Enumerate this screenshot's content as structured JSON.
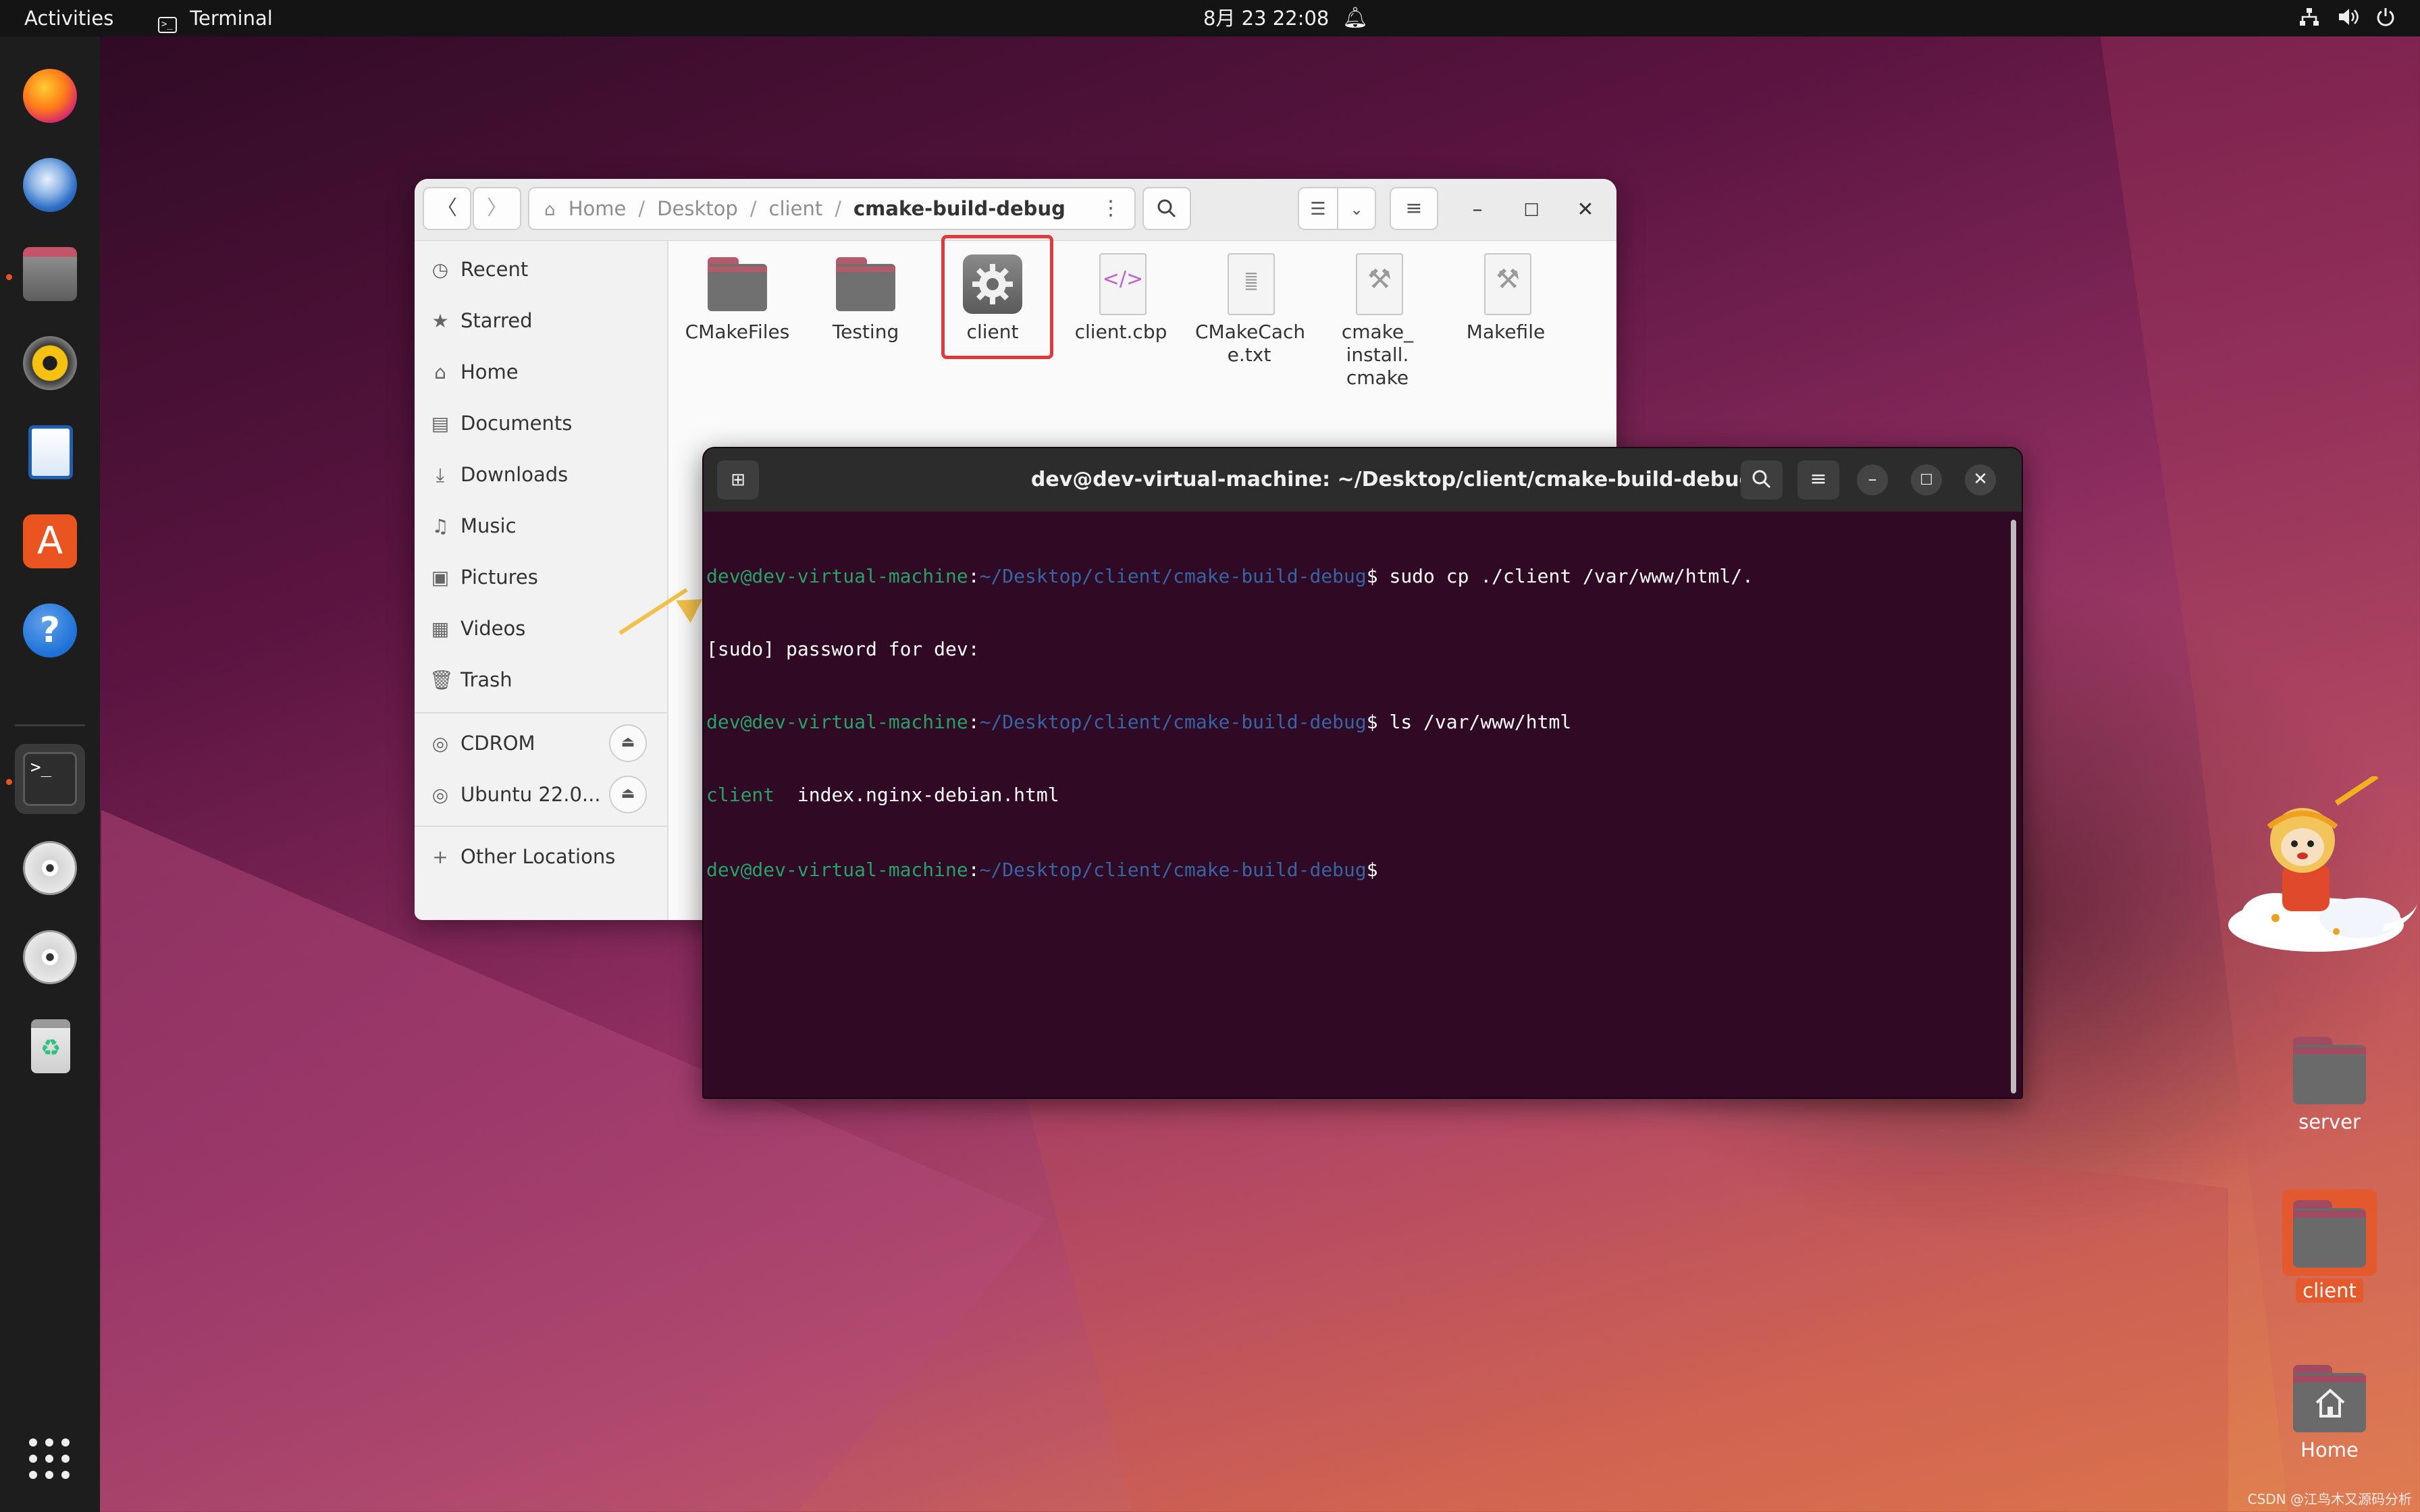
{
  "topbar": {
    "activities": "Activities",
    "app_name": "Terminal",
    "clock": "8月 23  22:08",
    "tray_icons": [
      "network-icon",
      "volume-icon",
      "power-icon"
    ]
  },
  "dock": {
    "apps": [
      "firefox-icon",
      "thunderbird-icon",
      "files-icon",
      "rhythmbox-icon",
      "writer-icon",
      "app-center-icon",
      "help-icon",
      "terminal-icon",
      "disc-icon",
      "disc-icon",
      "trash-icon"
    ],
    "show_apps_icon": "app-grid-icon"
  },
  "files": {
    "path": [
      "Home",
      "Desktop",
      "client",
      "cmake-build-debug"
    ],
    "sidebar": [
      {
        "label": "Recent",
        "icon": "clock-icon"
      },
      {
        "label": "Starred",
        "icon": "star-icon"
      },
      {
        "label": "Home",
        "icon": "home-icon"
      },
      {
        "label": "Documents",
        "icon": "document-icon"
      },
      {
        "label": "Downloads",
        "icon": "download-icon"
      },
      {
        "label": "Music",
        "icon": "music-icon"
      },
      {
        "label": "Pictures",
        "icon": "pictures-icon"
      },
      {
        "label": "Videos",
        "icon": "video-icon"
      },
      {
        "label": "Trash",
        "icon": "trash-icon"
      }
    ],
    "devices": [
      {
        "label": "CDROM",
        "icon": "disc-icon"
      },
      {
        "label": "Ubuntu 22.0...",
        "icon": "disc-icon"
      }
    ],
    "other_locations": "Other Locations",
    "items": [
      {
        "label": "CMakeFiles",
        "kind": "folder"
      },
      {
        "label": "Testing",
        "kind": "folder"
      },
      {
        "label": "client",
        "kind": "executable"
      },
      {
        "label": "client.cbp",
        "kind": "xml"
      },
      {
        "label": "CMakeCach\ne.txt",
        "kind": "text"
      },
      {
        "label": "cmake_\ninstall.\ncmake",
        "kind": "script"
      },
      {
        "label": "Makefile",
        "kind": "script"
      }
    ]
  },
  "terminal": {
    "title": "dev@dev-virtual-machine: ~/Desktop/client/cmake-build-debug",
    "prompt_user": "dev@dev-virtual-machine",
    "prompt_colon": ":",
    "prompt_path": "~/Desktop/client/cmake-build-debug",
    "prompt_symbol": "$",
    "lines": [
      {
        "type": "prompt",
        "cmd": " sudo cp ./client /var/www/html/."
      },
      {
        "type": "out",
        "text": "[sudo] password for dev:"
      },
      {
        "type": "prompt",
        "cmd": " ls /var/www/html"
      },
      {
        "type": "ls",
        "exec": "client",
        "rest": "  index.nginx-debian.html"
      },
      {
        "type": "prompt",
        "cmd": ""
      }
    ]
  },
  "desktop": {
    "icons": [
      {
        "label": "server",
        "kind": "folder"
      },
      {
        "label": "client",
        "kind": "folder"
      },
      {
        "label": "Home",
        "kind": "home"
      }
    ]
  },
  "watermark": "CSDN @江鸟木又源码分析"
}
